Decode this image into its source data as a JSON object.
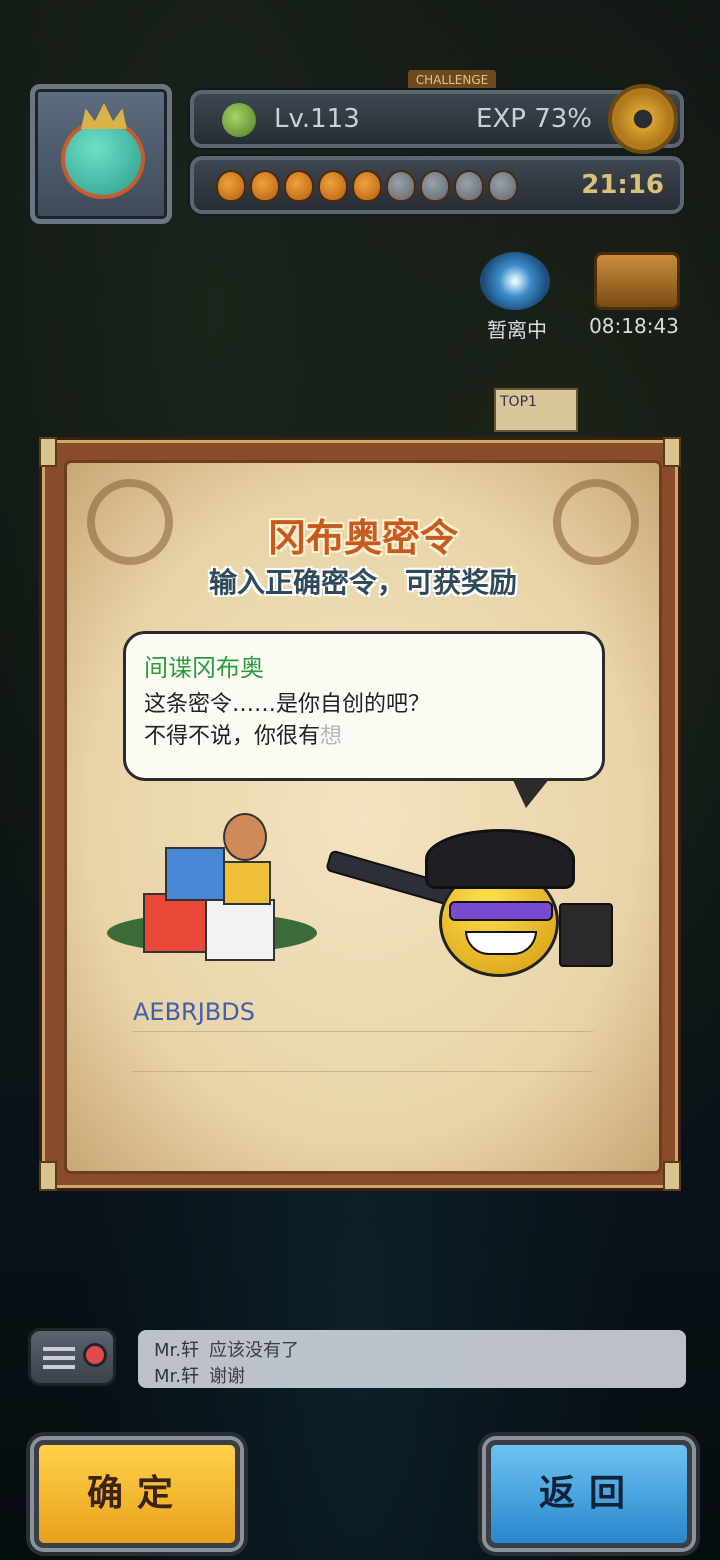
{
  "hud": {
    "level": "Lv.113",
    "exp": "EXP 73%",
    "exp_percent": 73,
    "stamina_timer": "21:16",
    "stamina_filled": 5,
    "stamina_total": 9,
    "challenge_label": "CHALLENGE",
    "portal_label": "暂离中",
    "chest_timer": "08:18:43",
    "top_badge": "TOP1"
  },
  "dialog": {
    "title": "冈布奥密令",
    "subtitle": "输入正确密令，可获奖励",
    "speaker": "间谍冈布奥",
    "line1": "这条密令……是你自创的吧？",
    "line2_main": "不得不说，你很有",
    "line2_fade": "想",
    "code_value": "AEBRJBDS"
  },
  "chat": {
    "messages": [
      {
        "user": "Mr.轩",
        "text": "应该没有了"
      },
      {
        "user": "Mr.轩",
        "text": "谢谢"
      }
    ]
  },
  "buttons": {
    "confirm": "确定",
    "back": "返回"
  },
  "colors": {
    "title": "#c85a1f",
    "speaker": "#2e9a3c",
    "code": "#3f5fb0",
    "confirm_btn": "#f2b62e",
    "back_btn": "#3c9ae0"
  }
}
